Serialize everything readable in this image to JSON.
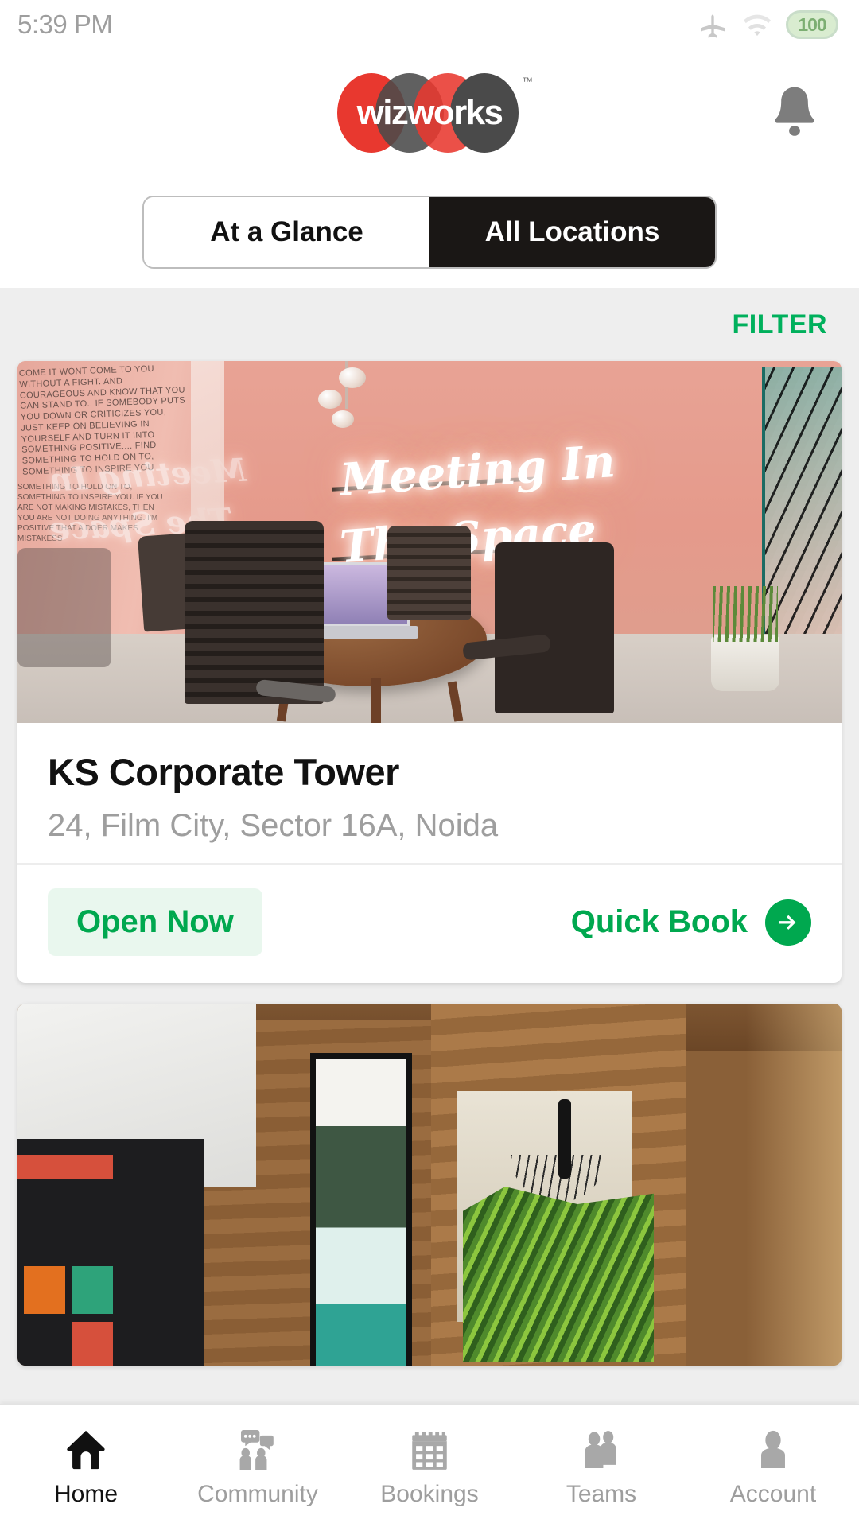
{
  "status_bar": {
    "time": "5:39 PM",
    "airplane_icon": "airplane-mode-icon",
    "wifi_icon": "wifi-icon",
    "battery_level": "100"
  },
  "header": {
    "logo_first": "wiz",
    "logo_second": "works",
    "trademark": "™",
    "notifications_icon": "bell-icon",
    "brand_red": "#e8382f",
    "brand_dark": "#4a4a4a"
  },
  "tabs": [
    {
      "label": "At a Glance",
      "active": false
    },
    {
      "label": "All Locations",
      "active": true
    }
  ],
  "toolbar": {
    "filter_label": "FILTER",
    "filter_color": "#00b05c"
  },
  "locations": [
    {
      "name": "KS Corporate Tower",
      "address": "24, Film City, Sector 16A, Noida",
      "status_label": "Open Now",
      "status_color": "#00a84f",
      "action_label": "Quick Book",
      "action_icon": "arrow-right-circle-icon",
      "photo_alt": "meeting-room-pink-neon",
      "neon_line1": "Meeting In",
      "neon_line2": "The Space",
      "wall_quote": "COME IT WONT COME TO YOU WITHOUT A FIGHT. AND COURAGEOUS AND KNOW THAT YOU CAN STAND TO.. IF SOMEBODY PUTS YOU DOWN OR CRITICIZES YOU, JUST KEEP ON BELIEVING IN YOURSELF AND TURN IT INTO SOMETHING POSITIVE.... FIND SOMETHING TO HOLD ON TO, SOMETHING TO INSPIRE YOU",
      "wall_quote2": "SOMETHING TO HOLD ON TO, SOMETHING TO INSPIRE YOU. IF YOU ARE NOT MAKING MISTAKES, THEN YOU ARE NOT DOING ANYTHING. I'M POSITIVE THAT A DOER MAKES MISTAKESS"
    },
    {
      "photo_alt": "wood-lobby-waterfall-art"
    }
  ],
  "bottom_nav": [
    {
      "label": "Home",
      "icon": "home-icon",
      "active": true
    },
    {
      "label": "Community",
      "icon": "chat-people-icon",
      "active": false
    },
    {
      "label": "Bookings",
      "icon": "calendar-icon",
      "active": false
    },
    {
      "label": "Teams",
      "icon": "people-icon",
      "active": false
    },
    {
      "label": "Account",
      "icon": "person-icon",
      "active": false
    }
  ]
}
